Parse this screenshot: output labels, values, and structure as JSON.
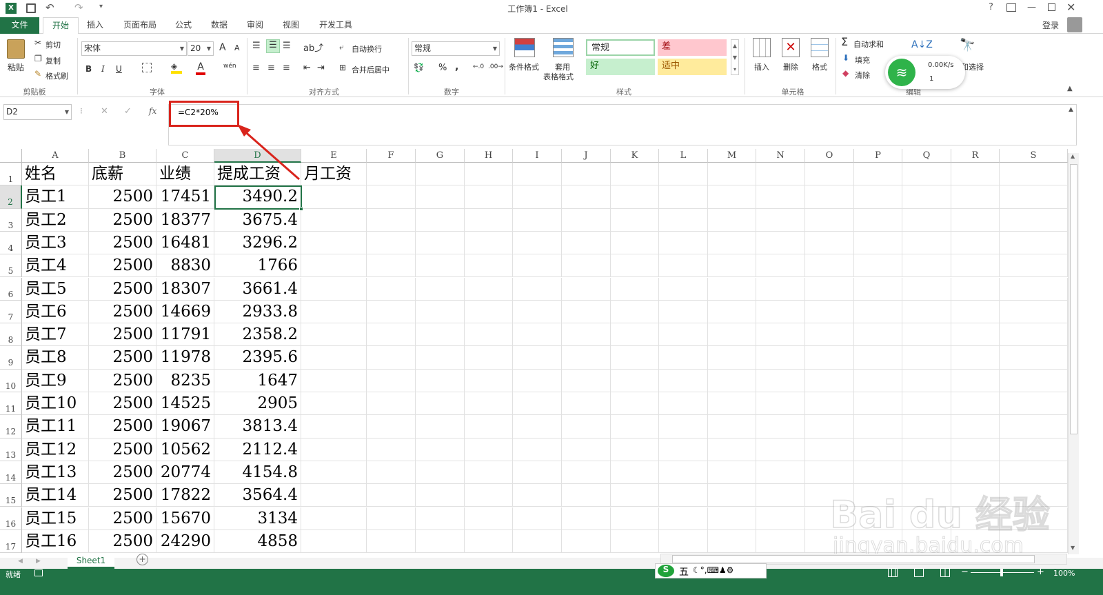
{
  "window": {
    "title": "工作簿1 - Excel",
    "help": "?",
    "login": "登录"
  },
  "tabs": [
    {
      "label": "文件",
      "active": false,
      "file": true
    },
    {
      "label": "开始",
      "active": true
    },
    {
      "label": "插入"
    },
    {
      "label": "页面布局"
    },
    {
      "label": "公式"
    },
    {
      "label": "数据"
    },
    {
      "label": "审阅"
    },
    {
      "label": "视图"
    },
    {
      "label": "开发工具"
    }
  ],
  "ribbon": {
    "clipboard": {
      "paste": "粘贴",
      "cut": "剪切",
      "copy": "复制",
      "format_painter": "格式刷",
      "label": "剪贴板"
    },
    "font": {
      "name": "宋体",
      "size": "20",
      "label": "字体",
      "bold": "B",
      "italic": "I",
      "underline": "U",
      "grow": "A",
      "shrink": "A",
      "font_color_glyph": "A",
      "phonetic": "wén"
    },
    "alignment": {
      "wrap": "自动换行",
      "merge": "合并后居中",
      "label": "对齐方式"
    },
    "number": {
      "format": "常规",
      "label": "数字",
      "percent": "%",
      "comma": ","
    },
    "styles": {
      "conditional": "条件格式",
      "table_format_1": "套用",
      "table_format_2": "表格格式",
      "normal": "常规",
      "bad": "差",
      "good": "好",
      "neutral": "适中",
      "label": "样式"
    },
    "cells": {
      "insert": "插入",
      "delete": "删除",
      "format": "格式",
      "label": "单元格"
    },
    "editing": {
      "autosum": "自动求和",
      "fill": "填充",
      "clear": "清除",
      "find": "和选择",
      "label": "编辑"
    },
    "overlay": {
      "speed": "0.00K/s",
      "count": "1"
    }
  },
  "formula_bar": {
    "name_box": "D2",
    "fx": "fx",
    "formula": "=C2*20%"
  },
  "columns": [
    "A",
    "B",
    "C",
    "D",
    "E",
    "F",
    "G",
    "H",
    "I",
    "J",
    "K",
    "L",
    "M",
    "N",
    "O",
    "P",
    "Q",
    "R",
    "S"
  ],
  "rows": [
    {
      "n": "1",
      "a": "姓名",
      "b": "底薪",
      "c": "业绩",
      "d": "提成工资",
      "e": "月工资"
    },
    {
      "n": "2",
      "a": "员工1",
      "b": "2500",
      "c": "17451",
      "d": "3490.2"
    },
    {
      "n": "3",
      "a": "员工2",
      "b": "2500",
      "c": "18377",
      "d": "3675.4"
    },
    {
      "n": "4",
      "a": "员工3",
      "b": "2500",
      "c": "16481",
      "d": "3296.2"
    },
    {
      "n": "5",
      "a": "员工4",
      "b": "2500",
      "c": "8830",
      "d": "1766"
    },
    {
      "n": "6",
      "a": "员工5",
      "b": "2500",
      "c": "18307",
      "d": "3661.4"
    },
    {
      "n": "7",
      "a": "员工6",
      "b": "2500",
      "c": "14669",
      "d": "2933.8"
    },
    {
      "n": "8",
      "a": "员工7",
      "b": "2500",
      "c": "11791",
      "d": "2358.2"
    },
    {
      "n": "9",
      "a": "员工8",
      "b": "2500",
      "c": "11978",
      "d": "2395.6"
    },
    {
      "n": "10",
      "a": "员工9",
      "b": "2500",
      "c": "8235",
      "d": "1647"
    },
    {
      "n": "11",
      "a": "员工10",
      "b": "2500",
      "c": "14525",
      "d": "2905"
    },
    {
      "n": "12",
      "a": "员工11",
      "b": "2500",
      "c": "19067",
      "d": "3813.4"
    },
    {
      "n": "13",
      "a": "员工12",
      "b": "2500",
      "c": "10562",
      "d": "2112.4"
    },
    {
      "n": "14",
      "a": "员工13",
      "b": "2500",
      "c": "20774",
      "d": "4154.8"
    },
    {
      "n": "15",
      "a": "员工14",
      "b": "2500",
      "c": "17822",
      "d": "3564.4"
    },
    {
      "n": "16",
      "a": "员工15",
      "b": "2500",
      "c": "15670",
      "d": "3134"
    },
    {
      "n": "17",
      "a": "员工16",
      "b": "2500",
      "c": "24290",
      "d": "4858"
    }
  ],
  "sheet_tab": "Sheet1",
  "status": {
    "ready": "就绪",
    "zoom": "100%",
    "ime": "五"
  },
  "watermark": {
    "brand": "Bai du 经验",
    "url": "jingyan.baidu.com"
  },
  "colors": {
    "excel_green": "#217346",
    "annotation_red": "#d9241c",
    "selected": "#217346"
  }
}
